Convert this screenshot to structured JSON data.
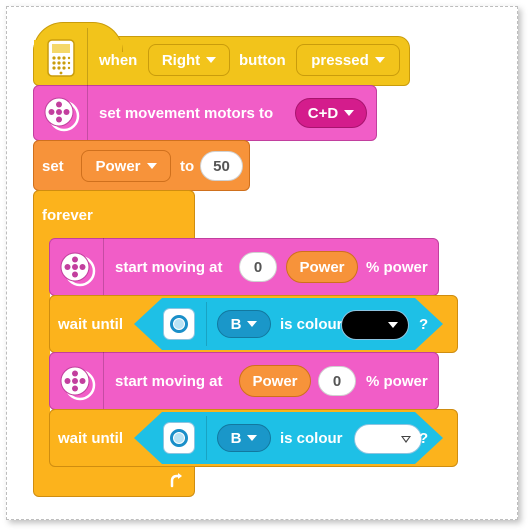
{
  "blocks": {
    "when": {
      "label_when": "when",
      "button_option": "Right",
      "label_button": "button",
      "state_option": "pressed"
    },
    "set_motors": {
      "label": "set movement motors to",
      "motors_option": "C+D"
    },
    "set_variable": {
      "label_set": "set",
      "variable_option": "Power",
      "label_to": "to",
      "value": "50"
    },
    "forever": {
      "label": "forever"
    },
    "move1": {
      "label": "start moving at",
      "left_value": "0",
      "right_value": "Power",
      "suffix": "% power"
    },
    "wait1": {
      "label": "wait until",
      "port_option": "B",
      "label_colour": "is colour",
      "colour": "#000000",
      "question": "?"
    },
    "move2": {
      "label": "start moving at",
      "left_value": "Power",
      "right_value": "0",
      "suffix": "% power"
    },
    "wait2": {
      "label": "wait until",
      "port_option": "B",
      "label_colour": "is colour",
      "colour": "#ffffff",
      "question": "?"
    }
  },
  "icons": {
    "hub_icon": "hub-icon",
    "motor_icon": "motor-icon",
    "color_sensor_icon": "color-sensor-icon",
    "loop_arrow": "loop-arrow-icon"
  }
}
